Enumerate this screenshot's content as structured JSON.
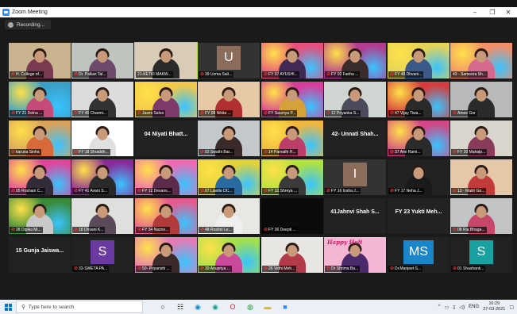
{
  "window": {
    "title": "Zoom Meeting",
    "minimize": "–",
    "maximize": "❐",
    "close": "✕"
  },
  "recording": {
    "label": "Recording..."
  },
  "participants": [
    {
      "label": "H. College of...",
      "bg": "#c9b48f",
      "shirt": "#7a3b52",
      "mic": true
    },
    {
      "label": "Dr. Pallavi Tal...",
      "bg": "#bfc4bf",
      "shirt": "#6d4a6a",
      "mic": true
    },
    {
      "label": "21-KETKI MAKW...",
      "bg": "#d8cbb7",
      "shirt": "#2a2a2a",
      "mic": false,
      "speaking": true
    },
    {
      "label": "39 Uzma Sait...",
      "bg": "#333333",
      "mic": true,
      "avatar": "U",
      "avatar_color": "#8c6d5c"
    },
    {
      "label": "FY 07 AYUSHI...",
      "bg": "#e6507d",
      "shirt": "#412a54",
      "mic": true,
      "colorful": true
    },
    {
      "label": "FY 02 Fariha ...",
      "bg": "#b23c8f",
      "shirt": "#3a2c2c",
      "mic": true,
      "colorful": true
    },
    {
      "label": "FY 48 Dhvani...",
      "bg": "#e3d35a",
      "shirt": "#3b5a8a",
      "mic": true,
      "colorful": true
    },
    {
      "label": "43 - Sameera Sh...",
      "bg": "#f08f6b",
      "shirt": "#d56a8e",
      "mic": false,
      "colorful": true
    },
    {
      "label": "FY 21 Delna ...",
      "bg": "#3aa0c8",
      "shirt": "#c64a7a",
      "mic": true,
      "colorful": true
    },
    {
      "label": "FY 45 Charmi...",
      "bg": "#dcdcdc",
      "shirt": "#333",
      "mic": true
    },
    {
      "label": "Jasmi Salva",
      "bg": "#f3c84a",
      "shirt": "#7d3a6a",
      "mic": true,
      "colorful": true
    },
    {
      "label": "FY 08 Nikita ...",
      "bg": "#e8c9a5",
      "shirt": "#b03030",
      "mic": true
    },
    {
      "label": "FY Saumya P...",
      "bg": "#d83c9a",
      "shirt": "#d7a13a",
      "mic": true,
      "colorful": true
    },
    {
      "label": "12 Priyanka S...",
      "bg": "#cfd6d2",
      "shirt": "#4b4b5c",
      "mic": true
    },
    {
      "label": "47 Vijay Tiwa...",
      "bg": "#d53c3c",
      "shirt": "#2a2a2a",
      "mic": true,
      "colorful": true
    },
    {
      "label": "Amee Gor",
      "bg": "#b7b9ba",
      "shirt": "#2b2b2b",
      "mic": true
    },
    {
      "label": "karuna Sinha",
      "bg": "#d8a25d",
      "shirt": "#d86a3a",
      "mic": true,
      "colorful": true
    },
    {
      "label": "FY 18 Shraddh...",
      "bg": "#ffffff",
      "shirt": "#e0e0e0",
      "mic": true
    },
    {
      "label": "04 Niyati Bhatt...",
      "bg": "#222222",
      "mic": false,
      "bigname": true
    },
    {
      "label": "02 Swathi Bar...",
      "bg": "#c3c9cd",
      "shirt": "#3a2a2a",
      "mic": true
    },
    {
      "label": "14 Parvathi H...",
      "bg": "#f0b640",
      "shirt": "#bd3d6b",
      "mic": true,
      "colorful": true
    },
    {
      "label": "42- Unnati Shah...",
      "bg": "#222222",
      "mic": false,
      "bigname": true
    },
    {
      "label": "37 Ami Rami...",
      "bg": "#d14785",
      "shirt": "#2b2b2b",
      "mic": true,
      "colorful": true
    },
    {
      "label": "FY 20 Mahalp...",
      "bg": "#d9d4cc",
      "shirt": "#8a3a5a",
      "mic": true
    },
    {
      "label": "05 Roshani C...",
      "bg": "#e0459c",
      "shirt": "#332a3a",
      "mic": true,
      "colorful": true
    },
    {
      "label": "FY 41 Avani S...",
      "bg": "#8a2a9a",
      "shirt": "#2a2a2a",
      "mic": true,
      "colorful": true
    },
    {
      "label": "FY 12 Devans...",
      "bg": "#ef6ab3",
      "shirt": "#5c2a4a",
      "mic": true,
      "colorful": true
    },
    {
      "label": "07 Lisette DC...",
      "bg": "#e2d23a",
      "shirt": "#2a6aa0",
      "mic": true,
      "colorful": true
    },
    {
      "label": "FY 33 Shreya ...",
      "bg": "#b3e13e",
      "shirt": "#3a3a3a",
      "mic": true,
      "colorful": true
    },
    {
      "label": "FY 16 Insha J...",
      "bg": "#333333",
      "mic": true,
      "avatar": "I",
      "avatar_color": "#8c6d5c"
    },
    {
      "label": "FY 17 Neha J...",
      "bg": "#222222",
      "shirt": "#1a1a1a",
      "mic": true
    },
    {
      "label": "13 - Maitri Go...",
      "bg": "#e6c8a8",
      "shirt": "#c33a3a",
      "mic": true
    },
    {
      "label": "28 Dipika Mi...",
      "bg": "#3a8a3a",
      "shirt": "#c8c8c8",
      "mic": true,
      "colorful": true
    },
    {
      "label": "18 Dhvani K...",
      "bg": "#dfe0dd",
      "shirt": "#5a4a5a",
      "mic": true
    },
    {
      "label": "FY 34 Nazne...",
      "bg": "#e65b90",
      "shirt": "#b23a3a",
      "mic": true,
      "colorful": true
    },
    {
      "label": "48 Roshni Le...",
      "bg": "#e9e7e2",
      "shirt": "#efefef",
      "mic": true
    },
    {
      "label": "FY 36 Deepti ...",
      "bg": "#0b0b0b",
      "mic": true,
      "darkbox": true
    },
    {
      "label": "41Jahnvi Shah S...",
      "bg": "#222222",
      "mic": false,
      "bigname": true
    },
    {
      "label": "FY 23 Yukti Meh...",
      "bg": "#222222",
      "mic": false,
      "bigname": true
    },
    {
      "label": "08 Ria Bhaga...",
      "bg": "#c2c4c6",
      "shirt": "#c7466a",
      "mic": true
    },
    {
      "label": "15 Gunja Jaiswa...",
      "bg": "#222222",
      "mic": false,
      "bigname": true
    },
    {
      "label": "33-SWETA PA...",
      "bg": "#222222",
      "mic": true,
      "avatar": "S",
      "avatar_color": "#6a3aa0"
    },
    {
      "label": "50- Priyanshi ...",
      "bg": "#e47bb5",
      "shirt": "#3a2a2a",
      "mic": true,
      "colorful": true
    },
    {
      "label": "30 Anupriya ...",
      "bg": "#a3e04b",
      "shirt": "#c94a9a",
      "mic": true,
      "colorful": true
    },
    {
      "label": "26 Vidhi Meh...",
      "bg": "#e8e6e3",
      "shirt": "#b23a4a",
      "mic": true
    },
    {
      "label": "Dr Shrima Ba...",
      "bg": "#f3b6d5",
      "shirt": "#4a2a6a",
      "mic": true,
      "holi": "Happy Holi"
    },
    {
      "label": "Dr.Manjeet S...",
      "bg": "#222222",
      "mic": true,
      "avatar": "MS",
      "avatar_color": "#1a86c9"
    },
    {
      "label": "01 Shashank...",
      "bg": "#222222",
      "mic": true,
      "avatar": "S",
      "avatar_color": "#1aa0a0"
    }
  ],
  "taskbar": {
    "search_placeholder": "Type here to search",
    "icons": [
      "task-view-icon",
      "widgets-icon",
      "edge-icon",
      "edge-beta-icon",
      "opera-icon",
      "chrome-icon",
      "file-explorer-icon",
      "zoom-icon"
    ],
    "tray": {
      "lang": "ENG",
      "time": "16:29",
      "date": "27-03-2021"
    }
  }
}
